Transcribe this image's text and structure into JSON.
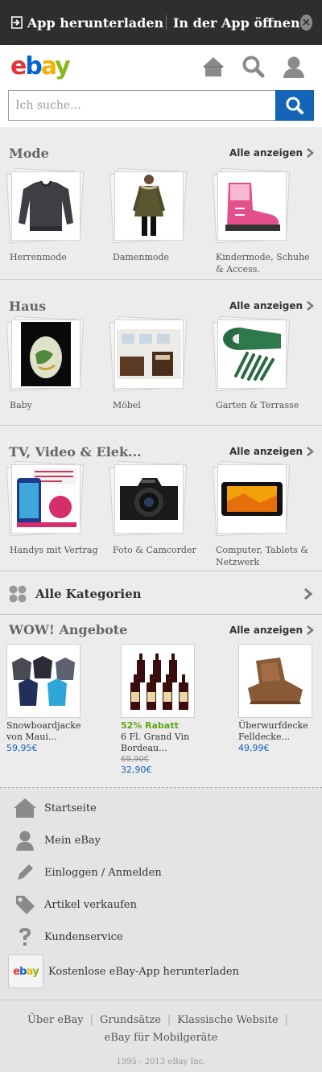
{
  "app_banner": {
    "download_label": "App herunterladen",
    "open_label": "In der App öffnen",
    "close_symbol": "×"
  },
  "header": {
    "logo_letters": [
      "e",
      "b",
      "a",
      "y"
    ],
    "search_placeholder": "Ich suche...",
    "icons": [
      "home-icon",
      "search-icon",
      "user-icon"
    ]
  },
  "sections": [
    {
      "title": "Mode",
      "see_all": "Alle anzeigen",
      "items": [
        {
          "label": "Herrenmode",
          "icon": "sweater-image"
        },
        {
          "label": "Damenmode",
          "icon": "parka-image"
        },
        {
          "label": "Kindermode, Schuhe & Access.",
          "icon": "kids-boot-image"
        }
      ]
    },
    {
      "title": "Haus",
      "see_all": "Alle anzeigen",
      "items": [
        {
          "label": "Baby",
          "icon": "belly-cast-image"
        },
        {
          "label": "Möbel",
          "icon": "furniture-image"
        },
        {
          "label": "Garten & Terrasse",
          "icon": "garden-fence-image"
        }
      ]
    },
    {
      "title": "TV, Video & Elek...",
      "see_all": "Alle anzeigen",
      "items": [
        {
          "label": "Handys mit Vertrag",
          "icon": "smartphone-offer-image"
        },
        {
          "label": "Foto & Camcorder",
          "icon": "camera-image"
        },
        {
          "label": "Computer, Tablets & Netzwerk",
          "icon": "tablet-image"
        }
      ]
    }
  ],
  "all_categories": {
    "label": "Alle Kategorien"
  },
  "wow": {
    "title": "WOW! Angebote",
    "see_all": "Alle anzeigen",
    "deals": [
      {
        "promo": "",
        "title": "Snowboardjacke von Maui...",
        "old_price": "",
        "price": "59,95€"
      },
      {
        "promo": "52% Rabatt",
        "title": "6 Fl. Grand Vin Bordeau...",
        "old_price": "69,90€",
        "price": "32,90€"
      },
      {
        "promo": "",
        "title": "Überwurfdecke Felldecke...",
        "old_price": "",
        "price": "49,99€"
      }
    ]
  },
  "footer_nav": [
    {
      "label": "Startseite",
      "icon": "home-icon"
    },
    {
      "label": "Mein eBay",
      "icon": "user-icon"
    },
    {
      "label": "Einloggen / Anmelden",
      "icon": "pencil-icon"
    },
    {
      "label": "Artikel verkaufen",
      "icon": "tag-icon"
    },
    {
      "label": "Kundenservice",
      "icon": "question-icon"
    },
    {
      "label": "Kostenlose eBay-App herunterladen",
      "icon": "ebay-app-icon"
    }
  ],
  "bottom_links": {
    "about": "Über eBay",
    "principles": "Grundsätze",
    "classic": "Klassische Website",
    "mobile": "eBay für Mobilgeräte",
    "separator": "|"
  },
  "copyright": "1995 - 2013 eBay Inc.",
  "colors": {
    "accent_blue": "#1465b8",
    "promo_green": "#5ea613",
    "banner_bg": "#2e2e2e"
  }
}
